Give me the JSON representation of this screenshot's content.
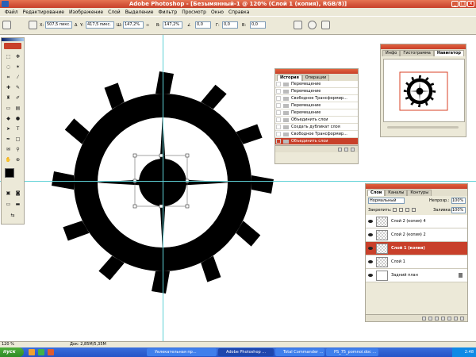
{
  "window": {
    "title": "Adobe Photoshop - [Безымянный-1 @ 120% (Слой 1 (копия), RGB/8)]",
    "controls": [
      "_",
      "□",
      "×"
    ]
  },
  "menu": [
    "Файл",
    "Редактирование",
    "Изображение",
    "Слой",
    "Выделение",
    "Фильтр",
    "Просмотр",
    "Окно",
    "Справка"
  ],
  "options": {
    "x_label": "X:",
    "x_value": "507,5 пикс.",
    "delta": "Δ",
    "y_label": "Y:",
    "y_value": "417,5 пикс.",
    "w_label": "Ш:",
    "w_value": "147,2%",
    "h_label": "В:",
    "h_value": "147,2%",
    "angle_value": "0,0",
    "skew_h_label": "Г:",
    "skew_h_value": "0,0",
    "skew_v_label": "В:",
    "skew_v_value": "0,0",
    "wells": [
      "Кисти",
      "Наст.инстр.",
      "Комп.слоев"
    ]
  },
  "history": {
    "tabs": [
      "История",
      "Операции"
    ],
    "items": [
      "Перемещение",
      "Перемещение",
      "Свободное Трансформир...",
      "Перемещение",
      "Перемещение",
      "Объединить слои",
      "Создать дубликат слоя",
      "Свободное Трансформир...",
      "Объединить слои"
    ],
    "selected_index": 8
  },
  "navigator": {
    "tabs": [
      "Инфо",
      "Гистограмма",
      "Навигатор"
    ]
  },
  "layers": {
    "tabs": [
      "Слои",
      "Каналы",
      "Контуры"
    ],
    "blend_mode": "Нормальный",
    "opacity_label": "Непрозр.:",
    "opacity_value": "100%",
    "lock_label": "Закрепить:",
    "fill_label": "Заливка:",
    "fill_value": "100%",
    "items": [
      {
        "name": "Слой 2 (копия) 4",
        "selected": false
      },
      {
        "name": "Слой 2 (копия) 2",
        "selected": false
      },
      {
        "name": "Слой 1 (копия)",
        "selected": true
      },
      {
        "name": "Слой 1",
        "selected": false
      },
      {
        "name": "Задний план",
        "selected": false,
        "locked": true
      }
    ]
  },
  "status": {
    "zoom": "120 %",
    "doc": "Док: 2,85М/5,35М"
  },
  "taskbar": {
    "start": "пуск",
    "tasks": [
      "Увлекательная пр...",
      "Adobe Photoshop ...",
      "Total Commander ...",
      "PS_75_pomnoi.doc ..."
    ],
    "clock": "2:48"
  }
}
